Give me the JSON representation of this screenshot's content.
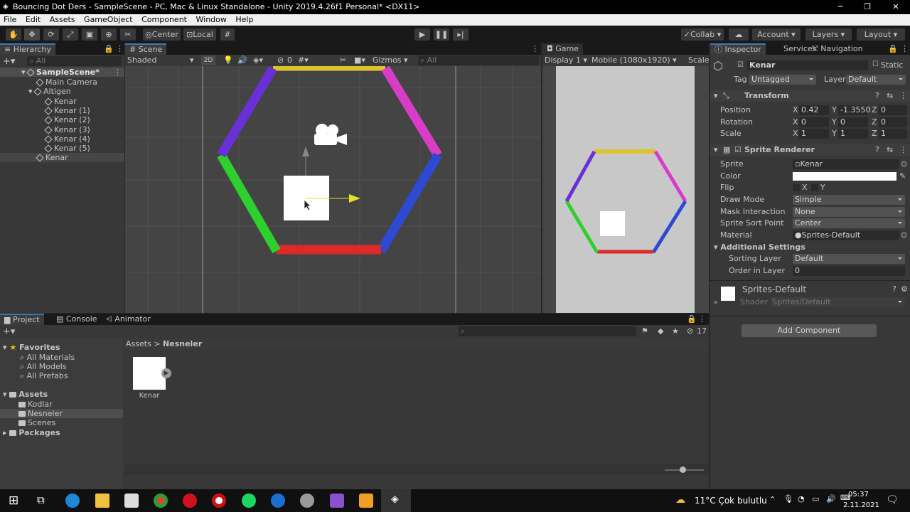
{
  "window": {
    "title": "Bouncing Dot Ders - SampleScene - PC, Mac & Linux Standalone - Unity 2019.4.26f1 Personal* <DX11>",
    "min": "─",
    "max": "❐",
    "close": "✕"
  },
  "menu": [
    "File",
    "Edit",
    "Assets",
    "GameObject",
    "Component",
    "Window",
    "Help"
  ],
  "toolbar": {
    "center": "Center",
    "local": "Local",
    "collab": "Collab",
    "account": "Account",
    "layers": "Layers",
    "layout": "Layout"
  },
  "hierarchy": {
    "tab": "Hierarchy",
    "search_placeholder": "All",
    "items": [
      {
        "label": "SampleScene*"
      },
      {
        "label": "Main Camera"
      },
      {
        "label": "Altigen"
      },
      {
        "label": "Kenar"
      },
      {
        "label": "Kenar (1)"
      },
      {
        "label": "Kenar (2)"
      },
      {
        "label": "Kenar (3)"
      },
      {
        "label": "Kenar (4)"
      },
      {
        "label": "Kenar (5)"
      },
      {
        "label": "Kenar"
      }
    ]
  },
  "scene": {
    "tab": "Scene",
    "shading": "Shaded",
    "mode2d": "2D",
    "hidden_count": "0",
    "gizmos": "Gizmos",
    "search_placeholder": "All"
  },
  "game": {
    "tab": "Game",
    "display": "Display 1",
    "resolution": "Mobile (1080x1920)",
    "scale": "Scale"
  },
  "inspector": {
    "tabs": [
      "Inspector",
      "Services",
      "Navigation"
    ],
    "object_name": "Kenar",
    "static_label": "Static",
    "tag_label": "Tag",
    "tag_value": "Untagged",
    "layer_label": "Layer",
    "layer_value": "Default",
    "transform": {
      "title": "Transform",
      "position_label": "Position",
      "rotation_label": "Rotation",
      "scale_label": "Scale",
      "position": [
        "0.42",
        "-1.3550",
        "0"
      ],
      "rotation": [
        "0",
        "0",
        "0"
      ],
      "scale": [
        "1",
        "1",
        "1"
      ],
      "axes": [
        "X",
        "Y",
        "Z"
      ]
    },
    "sprite_renderer": {
      "title": "Sprite Renderer",
      "sprite_label": "Sprite",
      "sprite_value": "Kenar",
      "color_label": "Color",
      "flip_label": "Flip",
      "flip_x": "X",
      "flip_y": "Y",
      "draw_mode_label": "Draw Mode",
      "draw_mode": "Simple",
      "mask_label": "Mask Interaction",
      "mask": "None",
      "sort_point_label": "Sprite Sort Point",
      "sort_point": "Center",
      "material_label": "Material",
      "material": "Sprites-Default",
      "additional": "Additional Settings",
      "sorting_layer_label": "Sorting Layer",
      "sorting_layer": "Default",
      "order_label": "Order in Layer",
      "order": "0"
    },
    "material": {
      "name": "Sprites-Default",
      "shader_label": "Shader",
      "shader": "Sprites/Default"
    },
    "add_component": "Add Component"
  },
  "project": {
    "tabs": [
      "Project",
      "Console",
      "Animator"
    ],
    "favorites": "Favorites",
    "fav_items": [
      "All Materials",
      "All Models",
      "All Prefabs"
    ],
    "assets": "Assets",
    "asset_items": [
      "Kodlar",
      "Nesneler",
      "Scenes"
    ],
    "packages": "Packages",
    "breadcrumb_root": "Assets",
    "breadcrumb_sep": ">",
    "breadcrumb_current": "Nesneler",
    "asset_label": "Kenar",
    "hidden_count": "17"
  },
  "taskbar": {
    "weather": "11°C  Çok bulutlu",
    "time": "05:37",
    "date": "2.11.2021"
  },
  "colors": {
    "yellow": "#dcc32c",
    "magenta": "#d83cc8",
    "blue": "#2e4ad2",
    "red": "#dc2a2a",
    "green": "#2ed02e",
    "purple": "#6a30d8"
  }
}
